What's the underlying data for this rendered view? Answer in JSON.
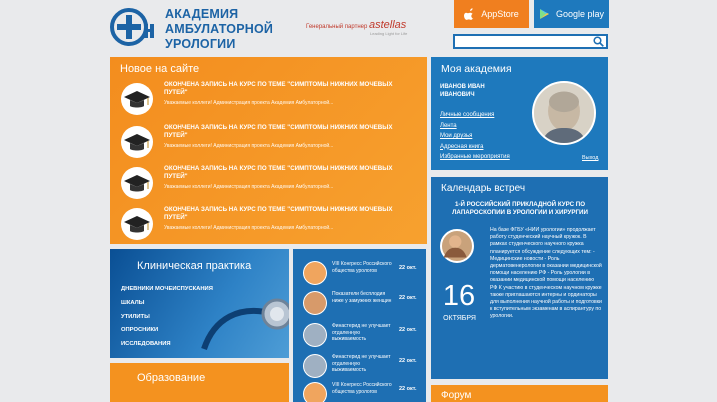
{
  "header": {
    "brand_line1": "АКАДЕМИЯ",
    "brand_line2": "АМБУЛАТОРНОЙ",
    "brand_line3": "УРОЛОГИИ",
    "partner_label": "Генеральный партнер",
    "partner_name": "astellas",
    "partner_tagline": "Leading Light for Life",
    "appstore_label": "AppStore",
    "gplay_label": "Google play",
    "search_placeholder": ""
  },
  "news": {
    "title": "Новое на сайте",
    "items": [
      {
        "headline": "ОКОНЧЕНА ЗАПИСЬ НА КУРС ПО ТЕМЕ \"СИМПТОМЫ НИЖНИХ МОЧЕВЫХ ПУТЕЙ\"",
        "snippet": "Уважаемые коллеги! Администрация проекта Академия Амбулаторной..."
      },
      {
        "headline": "ОКОНЧЕНА ЗАПИСЬ НА КУРС ПО ТЕМЕ \"СИМПТОМЫ НИЖНИХ МОЧЕВЫХ ПУТЕЙ\"",
        "snippet": "Уважаемые коллеги! Администрация проекта Академия Амбулаторной..."
      },
      {
        "headline": "ОКОНЧЕНА ЗАПИСЬ НА КУРС ПО ТЕМЕ \"СИМПТОМЫ НИЖНИХ МОЧЕВЫХ ПУТЕЙ\"",
        "snippet": "Уважаемые коллеги! Администрация проекта Академия Амбулаторной..."
      },
      {
        "headline": "ОКОНЧЕНА ЗАПИСЬ НА КУРС ПО ТЕМЕ \"СИМПТОМЫ НИЖНИХ МОЧЕВЫХ ПУТЕЙ\"",
        "snippet": "Уважаемые коллеги! Администрация проекта Академия Амбулаторной..."
      }
    ]
  },
  "academy": {
    "title": "Моя академия",
    "user_line1": "ИВАНОВ ИВАН",
    "user_line2": "ИВАНОВИЧ",
    "links": [
      "Личные сообщения",
      "Лента",
      "Мои друзья",
      "Адресная книга",
      "Избранные мероприятия"
    ],
    "exit_label": "Выход"
  },
  "calendar": {
    "title": "Календарь встреч",
    "event_title": "1-Й РОССИЙСКИЙ ПРИКЛАДНОЙ КУРС ПО ЛАПАРОСКОПИИ В УРОЛОГИИ И ХИРУРГИИ",
    "day": "16",
    "month": "ОКТЯБРЯ",
    "text": "На базе ФГБУ «НИИ урологии» продолжает работу студенческий научный кружок. В рамках студенческого научного кружка планируется обсуждение следующих тем: - Медицинские новости - Роль дерматовенерологии в оказании медицинской помощи населению РФ - Роль урологии в оказании медицинской помощи населению РФ К участию в студенческом научном кружке также приглашаются интерны и ординаторы для выполнения научной работы и подготовки к вступительным экзаменам в аспирантуру по урологии."
  },
  "clinical": {
    "title": "Клиническая практика",
    "items": [
      "ДНЕВНИКИ МОЧЕИСПУСКАНИЯ",
      "ШКАЛЫ",
      "УТИЛИТЫ",
      "ОПРОСНИКИ",
      "ИССЛЕДОВАНИЯ"
    ]
  },
  "news2": {
    "items": [
      {
        "text": "VIII Конгресс Российского общества урологов",
        "date": "22 окт."
      },
      {
        "text": "Показатели бесплодия ниже у замужних женщин",
        "date": "22 окт."
      },
      {
        "text": "Финастерид не улучшает отдаленную выживаемость",
        "date": "22 окт."
      },
      {
        "text": "Финастерид не улучшает отдаленную выживаемость",
        "date": "22 окт."
      },
      {
        "text": "VIII Конгресс Российского общества урологов",
        "date": "22 окт."
      }
    ]
  },
  "education": {
    "title": "Образование"
  },
  "forum": {
    "title": "Форум"
  }
}
